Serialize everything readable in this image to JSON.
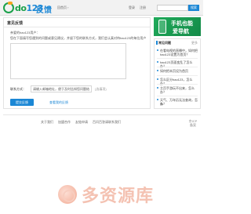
{
  "header": {
    "logo_letters": "do",
    "logo_digits": "123",
    "site_title": "反馈",
    "back_home": "回首页 ›",
    "login_label": "登录",
    "register_label": "注册",
    "search_placeholder": "",
    "search_button": "搜索"
  },
  "main": {
    "title": "意见反馈",
    "greeting": "亲爱的hao123用户：",
    "instructions": "您在下面填写您遇到的问题或意见建议，并留下您的联系方式，我们会认真对待hao123的每位用户",
    "feedback_value": "",
    "contact_label": "联系方式：",
    "contact_value": "请输入邮箱地址，便于及时告知您问题结果",
    "contact_hint": "(选填项)",
    "submit_label": "提交反馈",
    "view_feedback_label": "查看我的反馈"
  },
  "ad": {
    "line1": "手机也能",
    "line2": "爱导航"
  },
  "sidebar": {
    "title": "常见问题",
    "more": "更多",
    "items": [
      {
        "line1": "在看电视的直播中，如何把",
        "line2": "hao123设置为首页？"
      },
      {
        "line1": "hao123页面变乱了怎么办？",
        "line2": ""
      },
      {
        "line1": "如何把本页设为首页",
        "line2": ""
      },
      {
        "line1": "怎么区分hao123，怎么办？",
        "line2": ""
      },
      {
        "line1": "主页手游玩不出来，怎么",
        "line2": "办？"
      },
      {
        "line1": "天气、万年历无法查询，怎么",
        "line2": "办？"
      }
    ]
  },
  "footer": {
    "links": [
      "关于我们",
      "加盟合作",
      "友链申请",
      "百问百答请联系我们"
    ],
    "right_line1": "京ICP",
    "right_line2": "备案"
  },
  "watermark": {
    "text": "多资源库"
  }
}
